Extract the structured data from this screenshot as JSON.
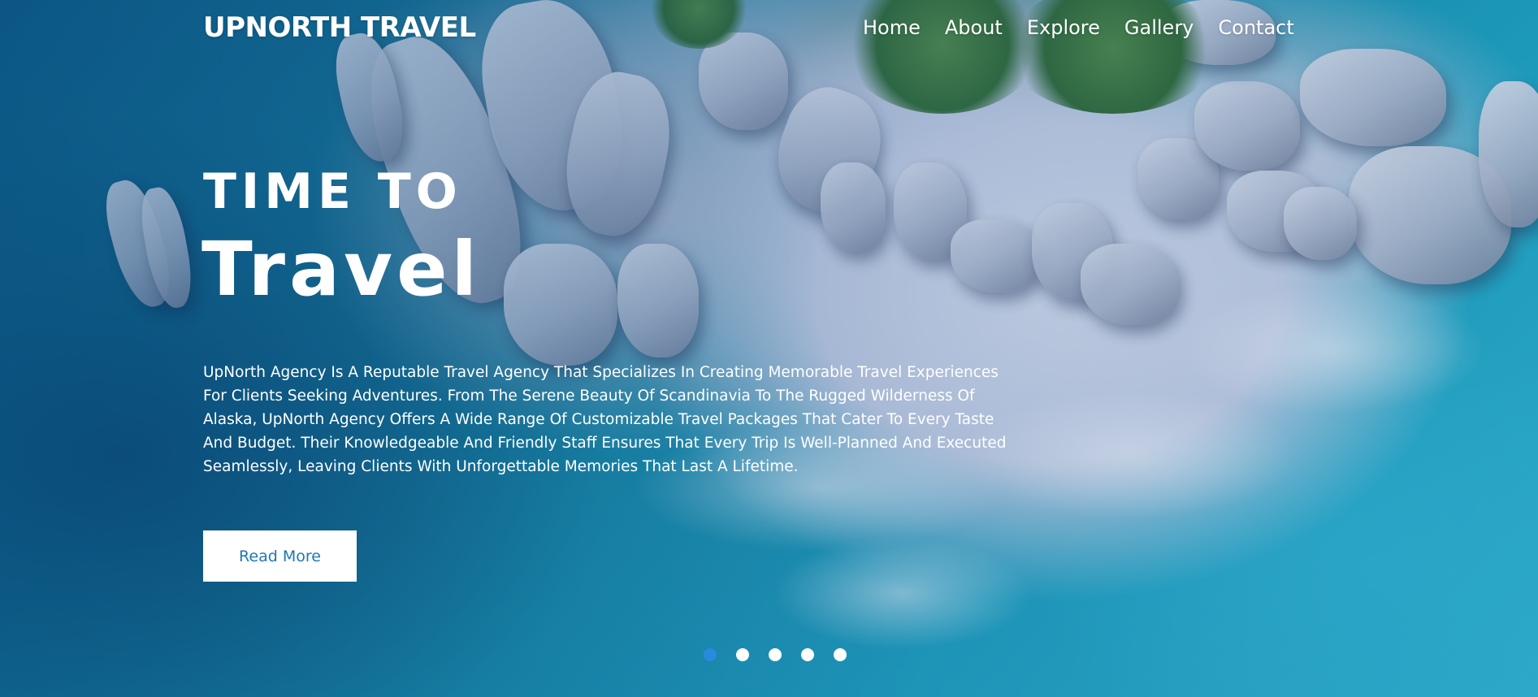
{
  "brand": {
    "name": "UPNORTH TRAVEL"
  },
  "nav": {
    "items": [
      {
        "label": "Home"
      },
      {
        "label": "About"
      },
      {
        "label": "Explore"
      },
      {
        "label": "Gallery"
      },
      {
        "label": "Contact"
      }
    ]
  },
  "hero": {
    "kicker": "TIME TO",
    "title": "Travel",
    "description": "UpNorth Agency Is A Reputable Travel Agency That Specializes In Creating Memorable Travel Experiences For Clients Seeking Adventures. From The Serene Beauty Of Scandinavia To The Rugged Wilderness Of Alaska, UpNorth Agency Offers A Wide Range Of Customizable Travel Packages That Cater To Every Taste And Budget. Their Knowledgeable And Friendly Staff Ensures That Every Trip Is Well-Planned And Executed Seamlessly, Leaving Clients With Unforgettable Memories That Last A Lifetime.",
    "cta_label": "Read More"
  },
  "slider": {
    "count": 5,
    "active_index": 0
  },
  "colors": {
    "accent": "#2a8ae0",
    "button_text": "#1e78b0",
    "text": "#ffffff"
  }
}
